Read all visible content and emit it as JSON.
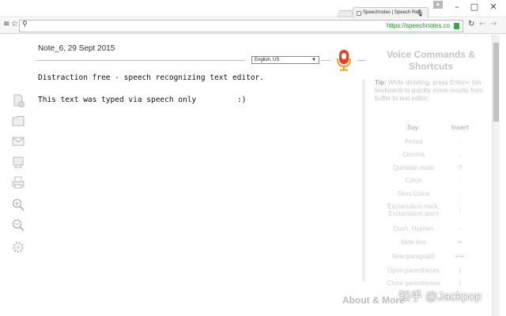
{
  "browser": {
    "tab_title": "Speechnotes | Speech Rec",
    "url": "https://speechnotes.co",
    "window_controls": [
      "minimize-icon",
      "maximize-icon",
      "close-icon"
    ]
  },
  "note": {
    "title": "Note_6, 29 Sept 2015",
    "language": "English, US",
    "lines": [
      "Distraction free - speech recognizing text editor.",
      "This text was typed via speech only"
    ],
    "smiley": ":)"
  },
  "side_icons": [
    "new-note-icon",
    "folder-icon",
    "email-icon",
    "cloud-icon",
    "print-icon",
    "zoom-in-icon",
    "zoom-out-icon",
    "settings-icon"
  ],
  "panel": {
    "title": "Voice Commands & Shortcuts",
    "tip_label": "Tip:",
    "tip_text": "While dictating, press Enter↵ (on keyboard) to quickly move results from buffer to text editor.",
    "col_say": "Say",
    "col_insert": "Insert",
    "commands": [
      {
        "say": "Period",
        "insert": "."
      },
      {
        "say": "Comma",
        "insert": ","
      },
      {
        "say": "Question mark",
        "insert": "?"
      },
      {
        "say": "Colon",
        "insert": ":"
      },
      {
        "say": "Semi Colon",
        "insert": ";"
      },
      {
        "say": "Exclamation mark, Exclamation point",
        "insert": "!"
      },
      {
        "say": "Dash, Hyphen",
        "insert": "-"
      },
      {
        "say": "New line",
        "insert": "↵"
      },
      {
        "say": "New paragraph",
        "insert": "↵↵"
      },
      {
        "say": "Open parentheses",
        "insert": "("
      },
      {
        "say": "Close parentheses",
        "insert": ")"
      }
    ],
    "about": "About & More"
  },
  "watermark": "知乎 @Jackpop",
  "colors": {
    "mic": "#e8401c",
    "url_green": "#1a8f2e"
  }
}
